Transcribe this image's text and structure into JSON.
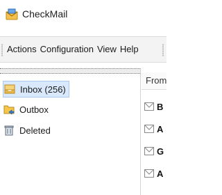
{
  "app": {
    "title": "CheckMail",
    "icon": "envelope-app-icon"
  },
  "menu": [
    "Actions",
    "Configuration",
    "View",
    "Help"
  ],
  "folders": [
    {
      "label": "Inbox (256)",
      "icon": "inbox-icon",
      "selected": true
    },
    {
      "label": "Outbox",
      "icon": "outbox-icon",
      "selected": false
    },
    {
      "label": "Deleted",
      "icon": "trash-icon",
      "selected": false
    }
  ],
  "list": {
    "column_header": "From",
    "rows": [
      {
        "initial": "B",
        "icon": "envelope-icon"
      },
      {
        "initial": "A",
        "icon": "envelope-icon"
      },
      {
        "initial": "G",
        "icon": "envelope-icon"
      },
      {
        "initial": "A",
        "icon": "envelope-icon"
      }
    ]
  },
  "colors": {
    "accent": "#f2a400",
    "selection": "#d9e8fb",
    "menubar": "#f3f3f3"
  }
}
